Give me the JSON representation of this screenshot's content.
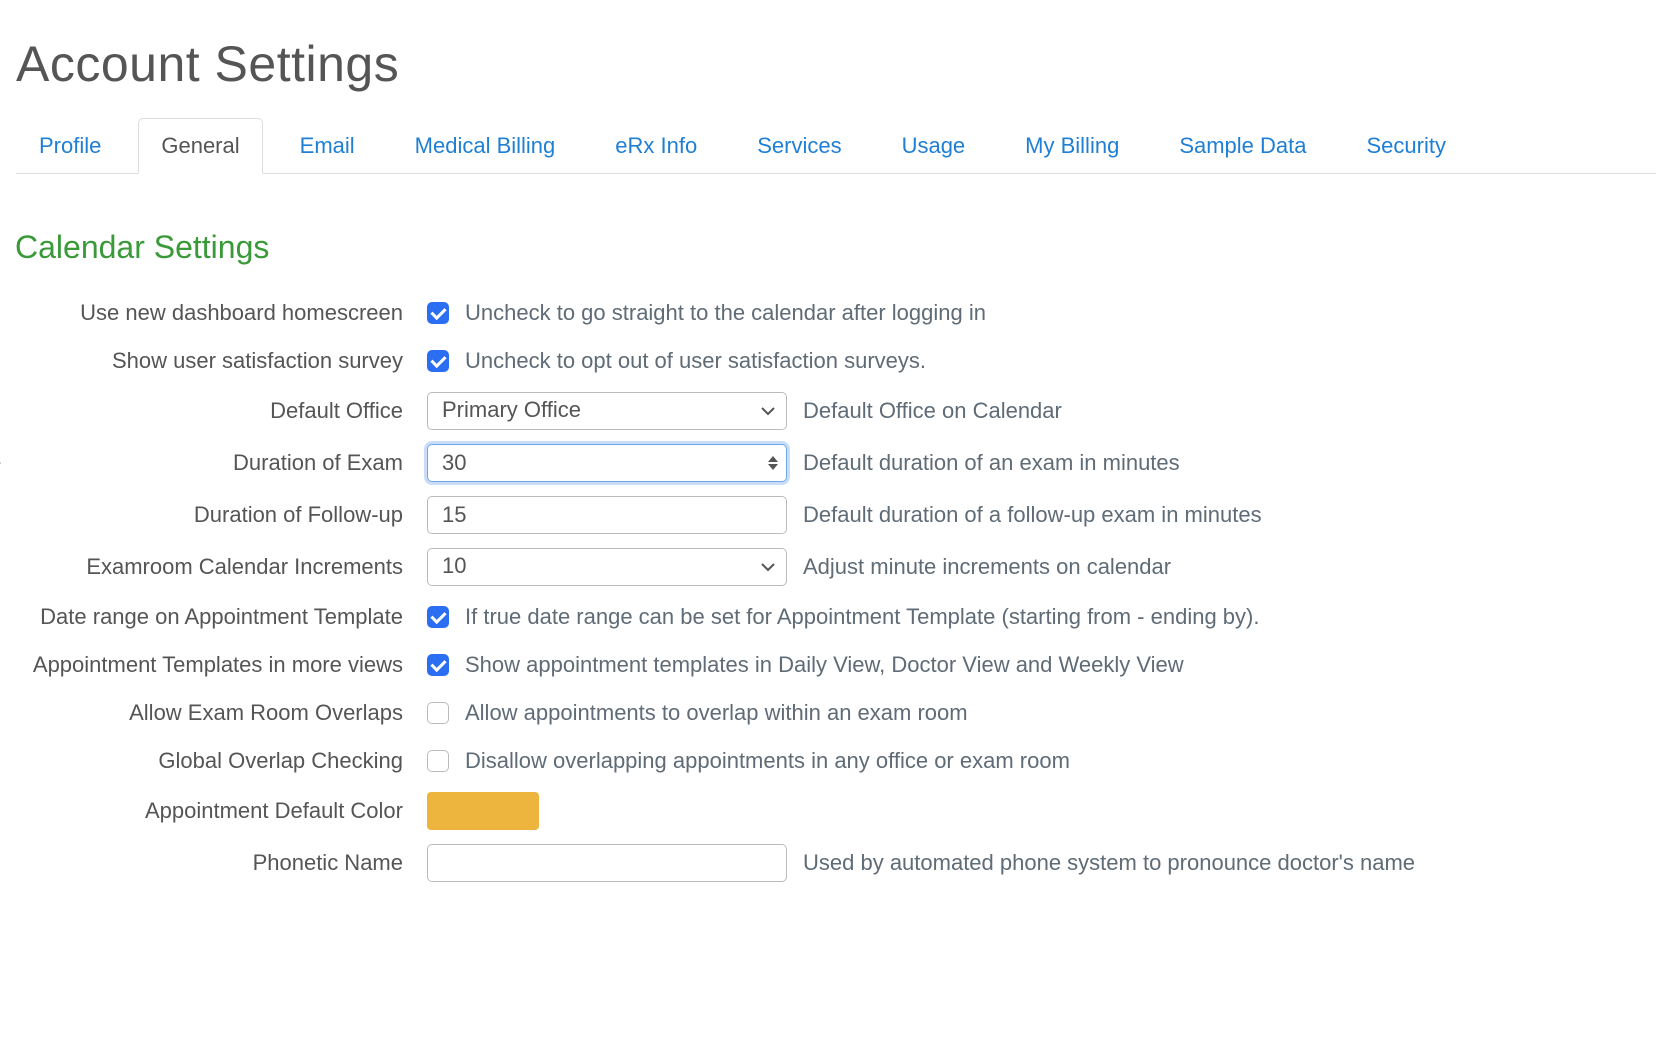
{
  "page_title": "Account Settings",
  "tabs": [
    {
      "label": "Profile",
      "active": false
    },
    {
      "label": "General",
      "active": true
    },
    {
      "label": "Email",
      "active": false
    },
    {
      "label": "Medical Billing",
      "active": false
    },
    {
      "label": "eRx Info",
      "active": false
    },
    {
      "label": "Services",
      "active": false
    },
    {
      "label": "Usage",
      "active": false
    },
    {
      "label": "My Billing",
      "active": false
    },
    {
      "label": "Sample Data",
      "active": false
    },
    {
      "label": "Security",
      "active": false
    }
  ],
  "section_title": "Calendar Settings",
  "fields": {
    "use_new_dashboard": {
      "label": "Use new dashboard homescreen",
      "checked": true,
      "help": "Uncheck to go straight to the calendar after logging in"
    },
    "show_survey": {
      "label": "Show user satisfaction survey",
      "checked": true,
      "help": "Uncheck to opt out of user satisfaction surveys."
    },
    "default_office": {
      "label": "Default Office",
      "value": "Primary Office",
      "help": "Default Office on Calendar"
    },
    "duration_exam": {
      "label": "Duration of Exam",
      "value": "30",
      "help": "Default duration of an exam in minutes"
    },
    "duration_followup": {
      "label": "Duration of Follow-up",
      "value": "15",
      "help": "Default duration of a follow-up exam in minutes"
    },
    "calendar_increments": {
      "label": "Examroom Calendar Increments",
      "value": "10",
      "help": "Adjust minute increments on calendar"
    },
    "date_range_template": {
      "label": "Date range on Appointment Template",
      "checked": true,
      "help": "If true date range can be set for Appointment Template (starting from - ending by)."
    },
    "templates_more_views": {
      "label": "Appointment Templates in more views",
      "checked": true,
      "help": "Show appointment templates in Daily View, Doctor View and Weekly View"
    },
    "allow_overlaps": {
      "label": "Allow Exam Room Overlaps",
      "checked": false,
      "help": "Allow appointments to overlap within an exam room"
    },
    "global_overlap": {
      "label": "Global Overlap Checking",
      "checked": false,
      "help": "Disallow overlapping appointments in any office or exam room"
    },
    "default_color": {
      "label": "Appointment Default Color",
      "value": "#eeb53e"
    },
    "phonetic_name": {
      "label": "Phonetic Name",
      "value": "",
      "help": "Used by automated phone system to pronounce doctor's name"
    }
  }
}
